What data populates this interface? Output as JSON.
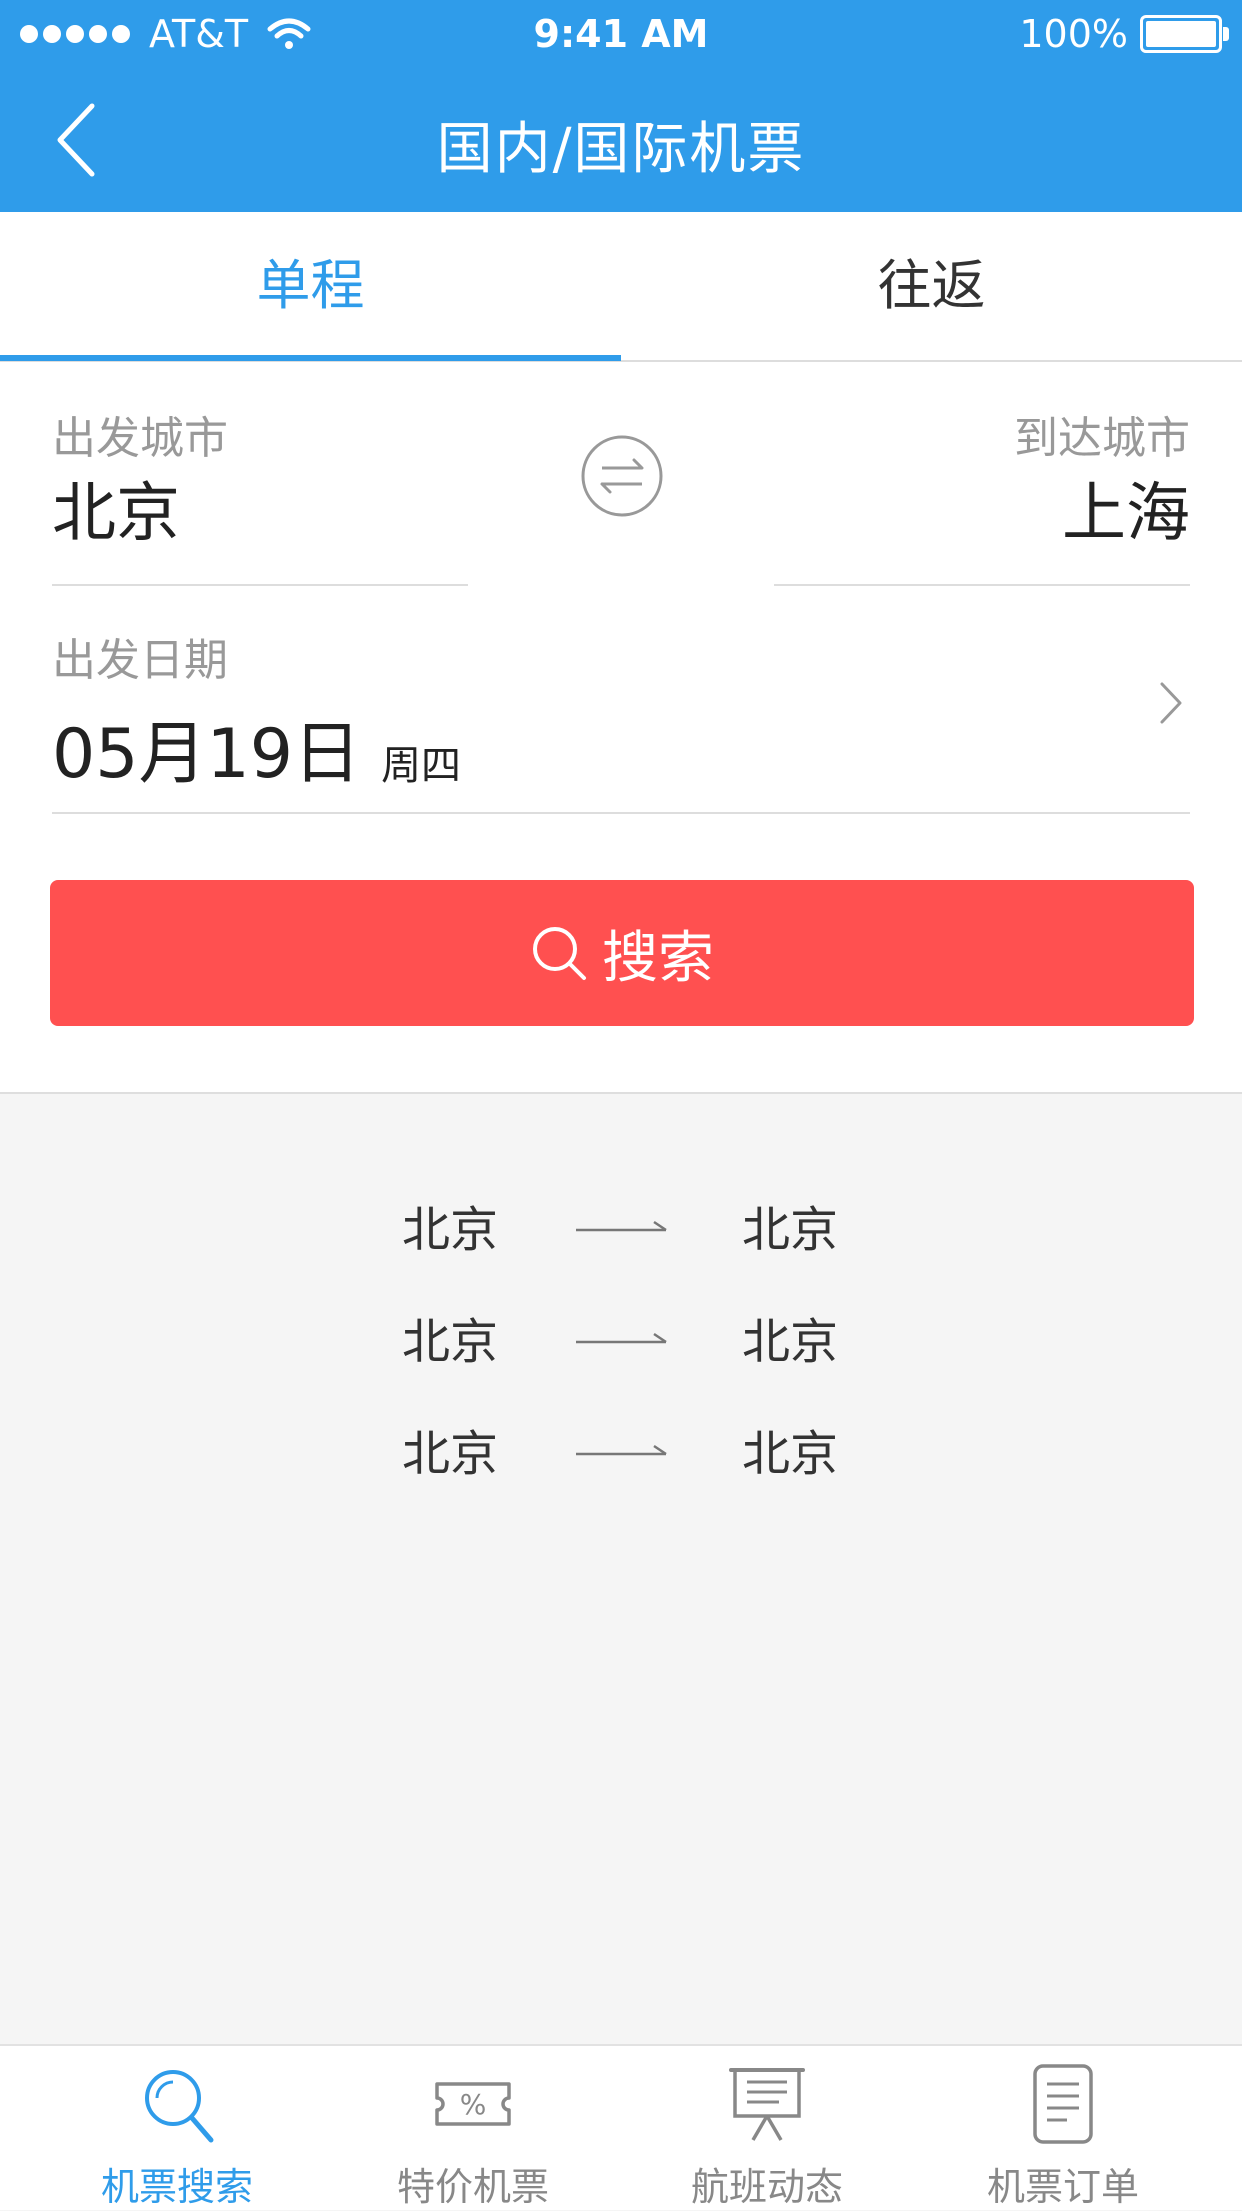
{
  "status_bar": {
    "carrier": "AT&T",
    "time": "9:41 AM",
    "battery": "100%"
  },
  "header": {
    "title": "国内/国际机票",
    "back_icon": "chevron-left-icon"
  },
  "tabs": [
    {
      "label": "单程",
      "active": true
    },
    {
      "label": "往返",
      "active": false
    }
  ],
  "form": {
    "departure_label": "出发城市",
    "departure_city": "北京",
    "arrival_label": "到达城市",
    "arrival_city": "上海",
    "date_label": "出发日期",
    "date_value": "05月19日",
    "weekday": "周四",
    "search_label": "搜索"
  },
  "history": [
    {
      "from": "北京",
      "to": "北京"
    },
    {
      "from": "北京",
      "to": "北京"
    },
    {
      "from": "北京",
      "to": "北京"
    }
  ],
  "bottom_nav": [
    {
      "label": "机票搜索",
      "icon": "search-icon",
      "active": true
    },
    {
      "label": "特价机票",
      "icon": "ticket-percent-icon",
      "active": false
    },
    {
      "label": "航班动态",
      "icon": "board-icon",
      "active": false
    },
    {
      "label": "机票订单",
      "icon": "document-icon",
      "active": false
    }
  ],
  "colors": {
    "primary": "#2f9cea",
    "search_button": "#ff5050",
    "background": "#f5f5f5"
  }
}
